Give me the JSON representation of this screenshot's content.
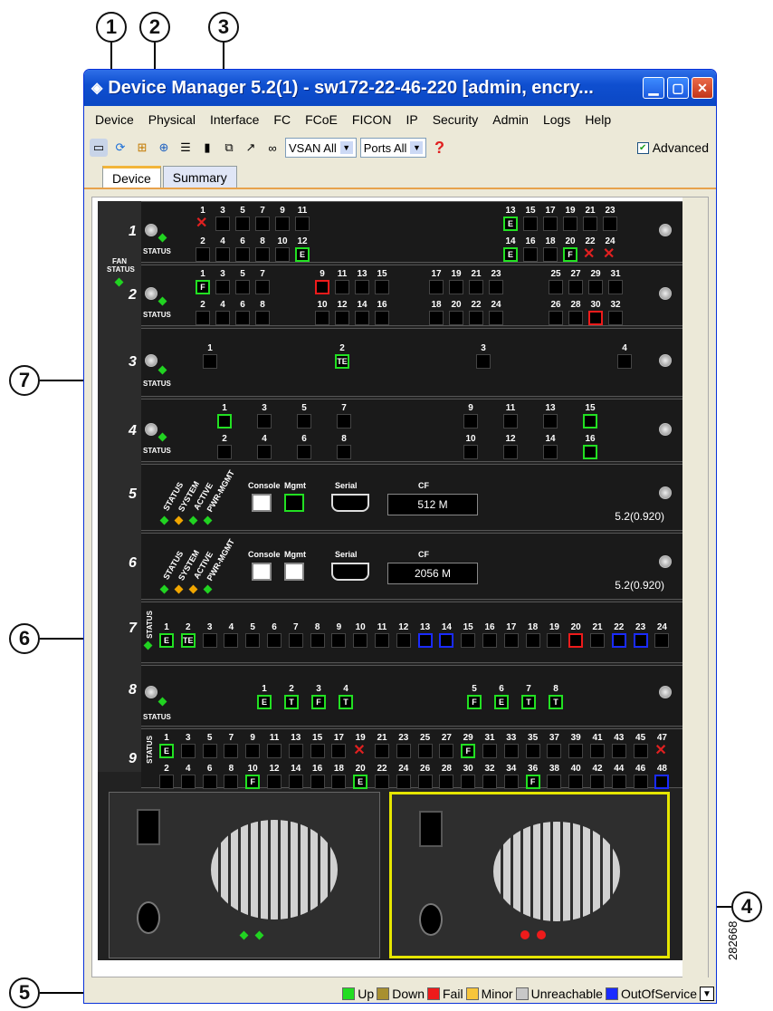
{
  "window": {
    "title": "Device Manager 5.2(1) - sw172-22-46-220 [admin, encry..."
  },
  "menu": [
    "Device",
    "Physical",
    "Interface",
    "FC",
    "FCoE",
    "FICON",
    "IP",
    "Security",
    "Admin",
    "Logs",
    "Help"
  ],
  "toolbar": {
    "vsan_select": "VSAN All",
    "ports_select": "Ports All",
    "advanced_label": "Advanced",
    "advanced_checked": true
  },
  "tabs": [
    "Device",
    "Summary"
  ],
  "callouts": [
    "1",
    "2",
    "3",
    "4",
    "5",
    "6",
    "7"
  ],
  "rail": {
    "fan_status": "FAN STATUS"
  },
  "slots": [
    {
      "no": "1",
      "status": "STATUS"
    },
    {
      "no": "2",
      "status": "STATUS"
    },
    {
      "no": "3",
      "status": "STATUS"
    },
    {
      "no": "4",
      "status": "STATUS"
    },
    {
      "no": "5",
      "labels": [
        "STATUS",
        "SYSTEM",
        "ACTIVE",
        "PWR-MGMT"
      ],
      "console": "Console",
      "mgmt": "Mgmt",
      "serial": "Serial",
      "cf": "CF",
      "cf_size": "512 M",
      "version": "5.2(0.920)"
    },
    {
      "no": "6",
      "labels": [
        "STATUS",
        "SYSTEM",
        "ACTIVE",
        "PWR-MGMT"
      ],
      "console": "Console",
      "mgmt": "Mgmt",
      "serial": "Serial",
      "cf": "CF",
      "cf_size": "2056 M",
      "version": "5.2(0.920)"
    },
    {
      "no": "7",
      "status": "STATUS"
    },
    {
      "no": "8",
      "status": "STATUS"
    },
    {
      "no": "9",
      "status": "STATUS"
    }
  ],
  "legend": [
    {
      "label": "Up",
      "color": "#22dd22"
    },
    {
      "label": "Down",
      "color": "#a89030"
    },
    {
      "label": "Fail",
      "color": "#ee1b1b"
    },
    {
      "label": "Minor",
      "color": "#f7c53a"
    },
    {
      "label": "Unreachable",
      "color": "#c8c8c8"
    },
    {
      "label": "OutOfService",
      "color": "#1a2bff"
    }
  ],
  "figure_id": "282668",
  "colors": {
    "up": "#22e022",
    "fail": "#ee1b1b",
    "oos": "#1a2bff",
    "title_bar": "#0f4fd0"
  }
}
